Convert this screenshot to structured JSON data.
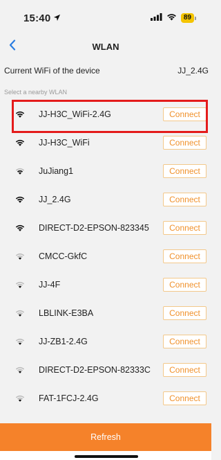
{
  "status_bar": {
    "time": "15:40",
    "battery": "89",
    "location_icon": "location-arrow-icon",
    "signal_icon": "cellular-signal-icon",
    "wifi_icon": "wifi-icon"
  },
  "nav": {
    "title": "WLAN",
    "back_icon": "chevron-left-icon"
  },
  "current": {
    "label": "Current WiFi of the device",
    "value": "JJ_2.4G"
  },
  "section_label": "Select a nearby WLAN",
  "networks": [
    {
      "name": "JJ-H3C_WiFi-2.4G",
      "action": "Connect",
      "signal": "strong"
    },
    {
      "name": "JJ-H3C_WiFi",
      "action": "Connect",
      "signal": "strong"
    },
    {
      "name": "JuJiang1",
      "action": "Connect",
      "signal": "medium"
    },
    {
      "name": "JJ_2.4G",
      "action": "Connect",
      "signal": "strong"
    },
    {
      "name": "DIRECT-D2-EPSON-823345",
      "action": "Connect",
      "signal": "strong"
    },
    {
      "name": "CMCC-GkfC",
      "action": "Connect",
      "signal": "weak"
    },
    {
      "name": "JJ-4F",
      "action": "Connect",
      "signal": "weak"
    },
    {
      "name": "LBLINK-E3BA",
      "action": "Connect",
      "signal": "weak"
    },
    {
      "name": "JJ-ZB1-2.4G",
      "action": "Connect",
      "signal": "weak"
    },
    {
      "name": "DIRECT-D2-EPSON-82333C",
      "action": "Connect",
      "signal": "weak"
    },
    {
      "name": "FAT-1FCJ-2.4G",
      "action": "Connect",
      "signal": "weak"
    }
  ],
  "refresh_label": "Refresh",
  "colors": {
    "accent": "#f5822a",
    "connect_text": "#f0902a",
    "highlight": "#e41b1b",
    "background": "#f2f2f2"
  }
}
